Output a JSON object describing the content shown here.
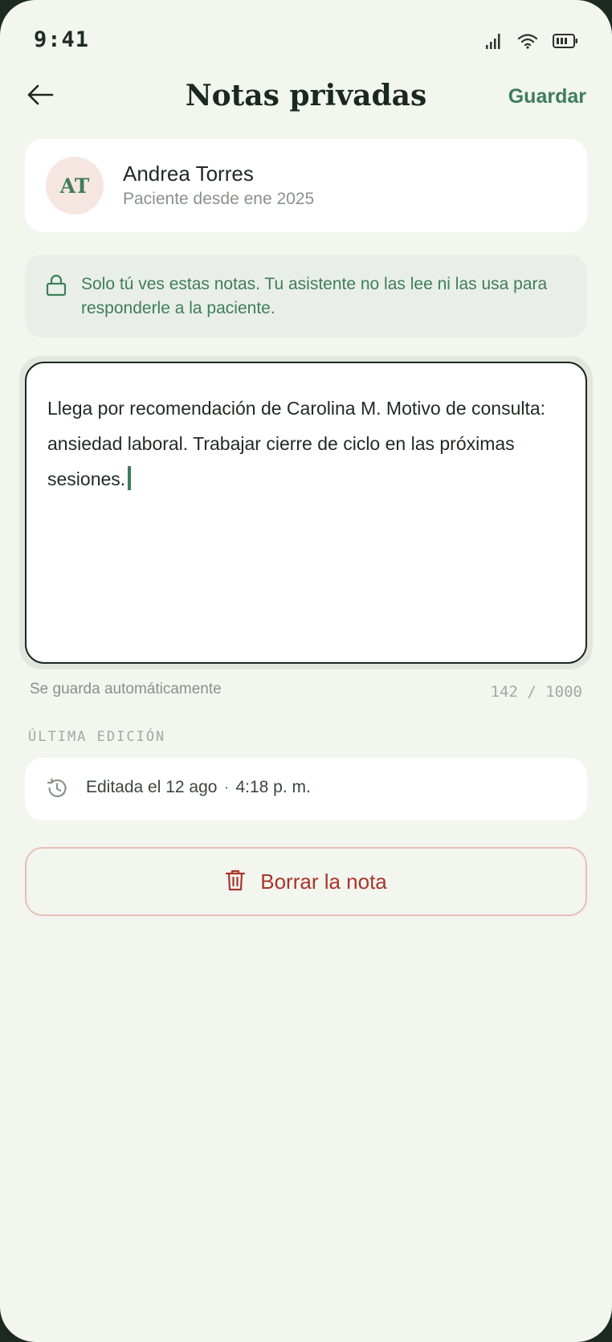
{
  "status_bar": {
    "time": "9:41",
    "icons": [
      "signal-icon",
      "wifi-icon",
      "battery-icon"
    ]
  },
  "header": {
    "back_icon": "arrow-left-icon",
    "title": "Notas privadas",
    "save_label": "Guardar"
  },
  "patient": {
    "initials": "AT",
    "name": "Andrea Torres",
    "since": "Paciente desde ene 2025"
  },
  "privacy_notice": {
    "icon": "lock-icon",
    "text": "Solo tú ves estas notas. Tu asistente no las lee ni las usa para responderle a la paciente."
  },
  "note": {
    "value": "Llega por recomendación de Carolina M. Motivo de consulta: ansiedad laboral. Trabajar cierre de ciclo en las próximas sesiones.",
    "autosave_label": "Se guarda automáticamente",
    "counter": "142 / 1000"
  },
  "last_edit": {
    "section_label": "ÚLTIMA EDICIÓN",
    "icon": "history-icon",
    "date": "Editada el 12 ago",
    "separator": "·",
    "time": "4:18 p. m."
  },
  "delete": {
    "icon": "trash-icon",
    "label": "Borrar la nota"
  },
  "colors": {
    "accent": "#3f7d5c",
    "background": "#f3f5ef",
    "danger": "#a8352a",
    "danger_border": "#e8bfb6",
    "avatar_bg": "#f6e6e1"
  }
}
